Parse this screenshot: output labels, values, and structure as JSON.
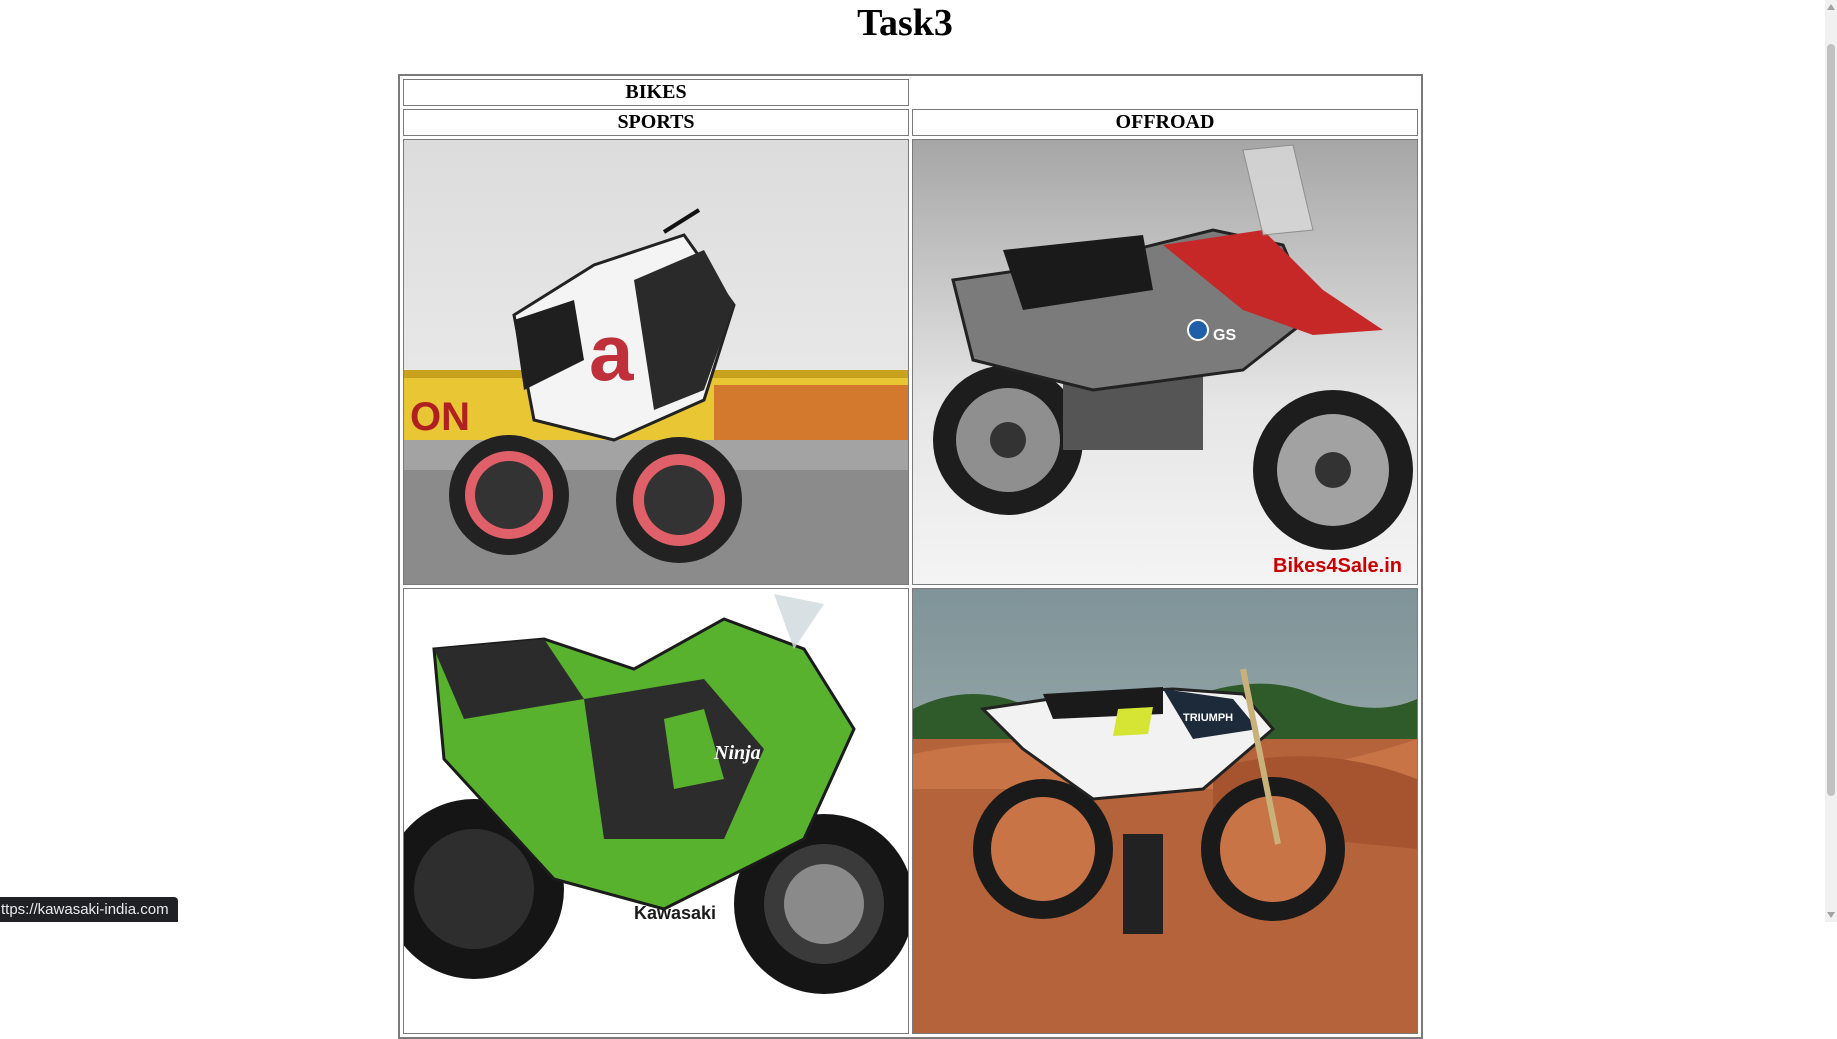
{
  "page": {
    "title": "Task3"
  },
  "table": {
    "caption": "BIKES",
    "columns": [
      "SPORTS",
      "OFFROAD"
    ],
    "images": [
      {
        "alt": "Aprilia sport bike",
        "watermark": ""
      },
      {
        "alt": "BMW GS adventure bike",
        "watermark": "Bikes4Sale.in"
      },
      {
        "alt": "Kawasaki Ninja green sport bike",
        "watermark": ""
      },
      {
        "alt": "Triumph dirt bike",
        "watermark": ""
      }
    ]
  },
  "status_bar": {
    "url": "ttps://kawasaki-india.com"
  }
}
